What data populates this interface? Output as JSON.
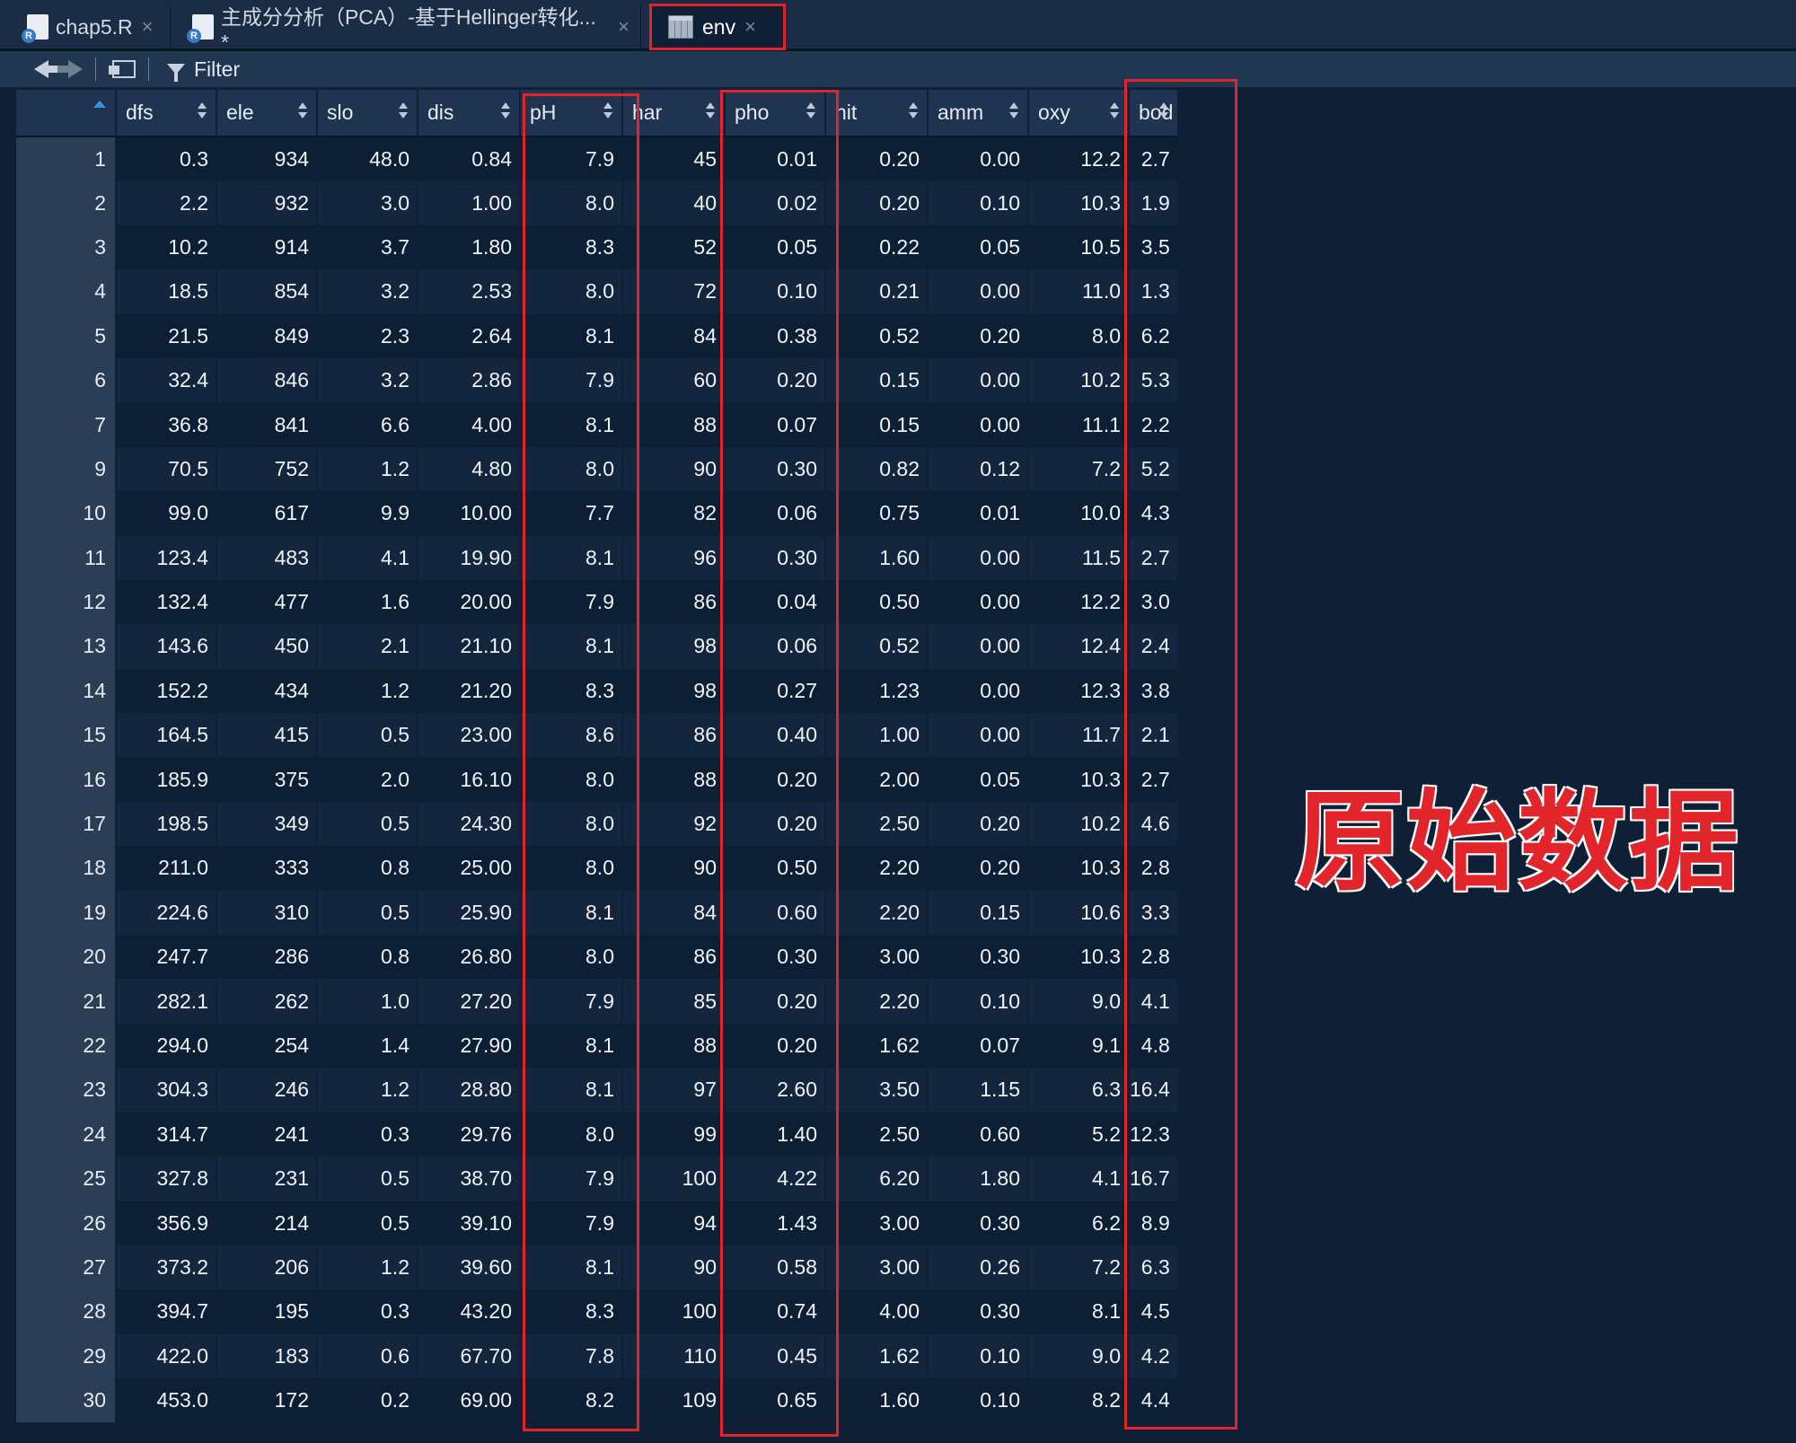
{
  "tabs": [
    {
      "label": "chap5.R",
      "icon": "r-script-icon",
      "active": false
    },
    {
      "label": "主成分分析（PCA）-基于Hellinger转化... *",
      "icon": "r-markdown-icon",
      "active": false
    },
    {
      "label": "env",
      "icon": "data-grid-icon",
      "active": true
    }
  ],
  "toolbar": {
    "filter_label": "Filter"
  },
  "table": {
    "columns": [
      "dfs",
      "ele",
      "slo",
      "dis",
      "pH",
      "har",
      "pho",
      "nit",
      "amm",
      "oxy",
      "bod"
    ],
    "rows": [
      [
        "1",
        "0.3",
        "934",
        "48.0",
        "0.84",
        "7.9",
        "45",
        "0.01",
        "0.20",
        "0.00",
        "12.2",
        "2.7"
      ],
      [
        "2",
        "2.2",
        "932",
        "3.0",
        "1.00",
        "8.0",
        "40",
        "0.02",
        "0.20",
        "0.10",
        "10.3",
        "1.9"
      ],
      [
        "3",
        "10.2",
        "914",
        "3.7",
        "1.80",
        "8.3",
        "52",
        "0.05",
        "0.22",
        "0.05",
        "10.5",
        "3.5"
      ],
      [
        "4",
        "18.5",
        "854",
        "3.2",
        "2.53",
        "8.0",
        "72",
        "0.10",
        "0.21",
        "0.00",
        "11.0",
        "1.3"
      ],
      [
        "5",
        "21.5",
        "849",
        "2.3",
        "2.64",
        "8.1",
        "84",
        "0.38",
        "0.52",
        "0.20",
        "8.0",
        "6.2"
      ],
      [
        "6",
        "32.4",
        "846",
        "3.2",
        "2.86",
        "7.9",
        "60",
        "0.20",
        "0.15",
        "0.00",
        "10.2",
        "5.3"
      ],
      [
        "7",
        "36.8",
        "841",
        "6.6",
        "4.00",
        "8.1",
        "88",
        "0.07",
        "0.15",
        "0.00",
        "11.1",
        "2.2"
      ],
      [
        "9",
        "70.5",
        "752",
        "1.2",
        "4.80",
        "8.0",
        "90",
        "0.30",
        "0.82",
        "0.12",
        "7.2",
        "5.2"
      ],
      [
        "10",
        "99.0",
        "617",
        "9.9",
        "10.00",
        "7.7",
        "82",
        "0.06",
        "0.75",
        "0.01",
        "10.0",
        "4.3"
      ],
      [
        "11",
        "123.4",
        "483",
        "4.1",
        "19.90",
        "8.1",
        "96",
        "0.30",
        "1.60",
        "0.00",
        "11.5",
        "2.7"
      ],
      [
        "12",
        "132.4",
        "477",
        "1.6",
        "20.00",
        "7.9",
        "86",
        "0.04",
        "0.50",
        "0.00",
        "12.2",
        "3.0"
      ],
      [
        "13",
        "143.6",
        "450",
        "2.1",
        "21.10",
        "8.1",
        "98",
        "0.06",
        "0.52",
        "0.00",
        "12.4",
        "2.4"
      ],
      [
        "14",
        "152.2",
        "434",
        "1.2",
        "21.20",
        "8.3",
        "98",
        "0.27",
        "1.23",
        "0.00",
        "12.3",
        "3.8"
      ],
      [
        "15",
        "164.5",
        "415",
        "0.5",
        "23.00",
        "8.6",
        "86",
        "0.40",
        "1.00",
        "0.00",
        "11.7",
        "2.1"
      ],
      [
        "16",
        "185.9",
        "375",
        "2.0",
        "16.10",
        "8.0",
        "88",
        "0.20",
        "2.00",
        "0.05",
        "10.3",
        "2.7"
      ],
      [
        "17",
        "198.5",
        "349",
        "0.5",
        "24.30",
        "8.0",
        "92",
        "0.20",
        "2.50",
        "0.20",
        "10.2",
        "4.6"
      ],
      [
        "18",
        "211.0",
        "333",
        "0.8",
        "25.00",
        "8.0",
        "90",
        "0.50",
        "2.20",
        "0.20",
        "10.3",
        "2.8"
      ],
      [
        "19",
        "224.6",
        "310",
        "0.5",
        "25.90",
        "8.1",
        "84",
        "0.60",
        "2.20",
        "0.15",
        "10.6",
        "3.3"
      ],
      [
        "20",
        "247.7",
        "286",
        "0.8",
        "26.80",
        "8.0",
        "86",
        "0.30",
        "3.00",
        "0.30",
        "10.3",
        "2.8"
      ],
      [
        "21",
        "282.1",
        "262",
        "1.0",
        "27.20",
        "7.9",
        "85",
        "0.20",
        "2.20",
        "0.10",
        "9.0",
        "4.1"
      ],
      [
        "22",
        "294.0",
        "254",
        "1.4",
        "27.90",
        "8.1",
        "88",
        "0.20",
        "1.62",
        "0.07",
        "9.1",
        "4.8"
      ],
      [
        "23",
        "304.3",
        "246",
        "1.2",
        "28.80",
        "8.1",
        "97",
        "2.60",
        "3.50",
        "1.15",
        "6.3",
        "16.4"
      ],
      [
        "24",
        "314.7",
        "241",
        "0.3",
        "29.76",
        "8.0",
        "99",
        "1.40",
        "2.50",
        "0.60",
        "5.2",
        "12.3"
      ],
      [
        "25",
        "327.8",
        "231",
        "0.5",
        "38.70",
        "7.9",
        "100",
        "4.22",
        "6.20",
        "1.80",
        "4.1",
        "16.7"
      ],
      [
        "26",
        "356.9",
        "214",
        "0.5",
        "39.10",
        "7.9",
        "94",
        "1.43",
        "3.00",
        "0.30",
        "6.2",
        "8.9"
      ],
      [
        "27",
        "373.2",
        "206",
        "1.2",
        "39.60",
        "8.1",
        "90",
        "0.58",
        "3.00",
        "0.26",
        "7.2",
        "6.3"
      ],
      [
        "28",
        "394.7",
        "195",
        "0.3",
        "43.20",
        "8.3",
        "100",
        "0.74",
        "4.00",
        "0.30",
        "8.1",
        "4.5"
      ],
      [
        "29",
        "422.0",
        "183",
        "0.6",
        "67.70",
        "7.8",
        "110",
        "0.45",
        "1.62",
        "0.10",
        "9.0",
        "4.2"
      ],
      [
        "30",
        "453.0",
        "172",
        "0.2",
        "69.00",
        "8.2",
        "109",
        "0.65",
        "1.60",
        "0.10",
        "8.2",
        "4.4"
      ]
    ]
  },
  "annotation": {
    "label": "原始数据",
    "color": "#e2242b"
  },
  "colors": {
    "highlight": "#e0242c",
    "sort_active": "#3b8fe0",
    "background": "#0f2036"
  }
}
